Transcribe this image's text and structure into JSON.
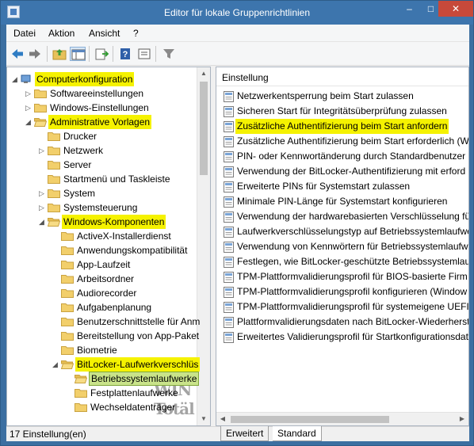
{
  "window": {
    "title": "Editor für lokale Gruppenrichtlinien",
    "min": "–",
    "max": "□",
    "close": "✕"
  },
  "menu": [
    "Datei",
    "Aktion",
    "Ansicht",
    "?"
  ],
  "toolbar": [
    "back-arrow-icon",
    "forward-arrow-icon",
    "up-folder-icon",
    "show-hide-tree-icon",
    "export-list-icon",
    "help-icon",
    "properties-icon",
    "filter-icon"
  ],
  "tree": {
    "items": [
      {
        "label": "Computerkonfiguration",
        "state": "highlight"
      },
      {
        "label": "Softwareeinstellungen"
      },
      {
        "label": "Windows-Einstellungen"
      },
      {
        "label": "Administrative Vorlagen",
        "state": "highlight"
      },
      {
        "label": "Drucker"
      },
      {
        "label": "Netzwerk"
      },
      {
        "label": "Server"
      },
      {
        "label": "Startmenü und Taskleiste"
      },
      {
        "label": "System"
      },
      {
        "label": "Systemsteuerung"
      },
      {
        "label": "Windows-Komponenten",
        "state": "highlight"
      },
      {
        "label": "ActiveX-Installerdienst"
      },
      {
        "label": "Anwendungskompatibilität"
      },
      {
        "label": "App-Laufzeit"
      },
      {
        "label": "Arbeitsordner"
      },
      {
        "label": "Audiorecorder"
      },
      {
        "label": "Aufgabenplanung"
      },
      {
        "label": "Benutzerschnittstelle für Anm"
      },
      {
        "label": "Bereitstellung von App-Paket"
      },
      {
        "label": "Biometrie"
      },
      {
        "label": "BitLocker-Laufwerkverschlüs",
        "state": "highlight"
      },
      {
        "label": "Betriebssystemlaufwerke",
        "state": "selected"
      },
      {
        "label": "Festplattenlaufwerke"
      },
      {
        "label": "Wechseldatenträger"
      }
    ]
  },
  "list": {
    "header": "Einstellung",
    "items": [
      "Netzwerkentsperrung beim Start zulassen",
      "Sicheren Start für Integritätsüberprüfung zulassen",
      "Zusätzliche Authentifizierung beim Start anfordern",
      "Zusätzliche Authentifizierung beim Start erforderlich (W",
      "PIN- oder Kennwortänderung durch Standardbenutzer n",
      "Verwendung der BitLocker-Authentifizierung mit erford",
      "Erweiterte PINs für Systemstart zulassen",
      "Minimale PIN-Länge für Systemstart konfigurieren",
      "Verwendung der hardwarebasierten Verschlüsselung für",
      "Laufwerkverschlüsselungstyp auf Betriebssystemlaufwe",
      "Verwendung von Kennwörtern für Betriebssystemlaufwe",
      "Festlegen, wie BitLocker-geschützte Betriebssystemlaufw",
      "TPM-Plattformvalidierungsprofil für BIOS-basierte Firm",
      "TPM-Plattformvalidierungsprofil konfigurieren (Window",
      "TPM-Plattformvalidierungsprofil für systemeigene UEFI",
      "Plattformvalidierungsdaten nach BitLocker-Wiederherst",
      "Erweitertes Validierungsprofil für Startkonfigurationsdat"
    ],
    "highlighted_index": 2
  },
  "tabs": [
    "Erweitert",
    "Standard"
  ],
  "status": "17 Einstellung(en)",
  "watermark": "WIN Totäl",
  "colors": {
    "highlight": "#f5f200",
    "selected": "#c9e38a",
    "titlebar": "#3d75ad"
  }
}
